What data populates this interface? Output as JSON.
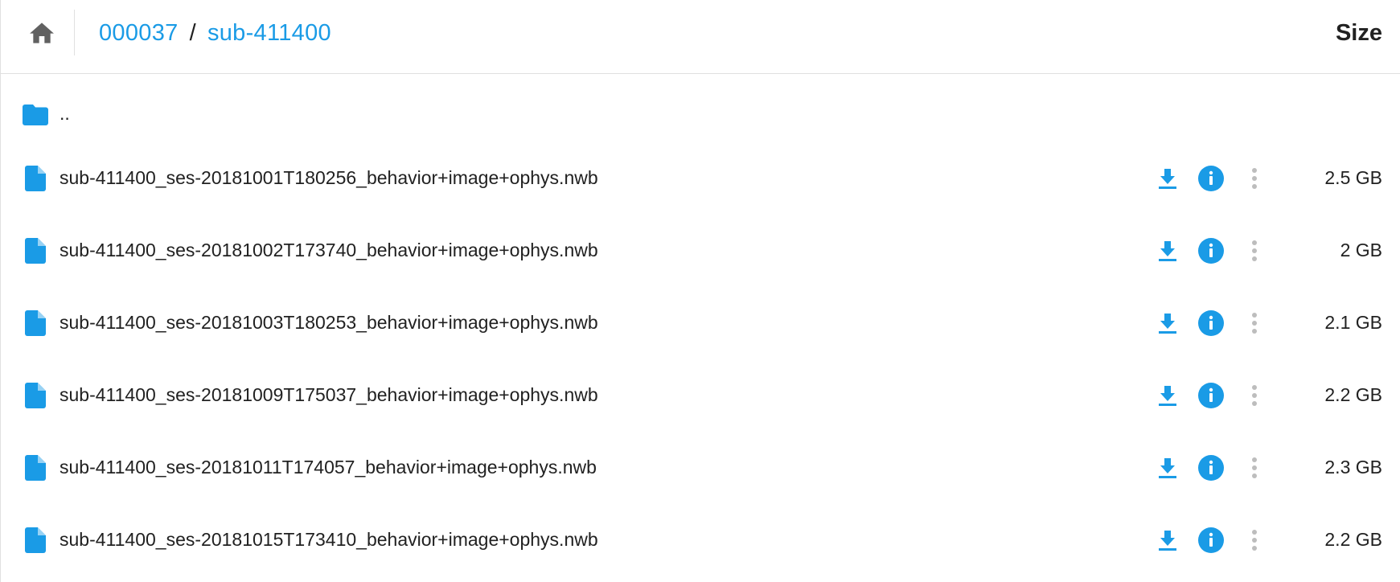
{
  "colors": {
    "accent": "#1a9be6",
    "icon_gray": "#616161",
    "more_gray": "#bdbdbd",
    "text": "#212121",
    "divider": "#e0e0e0"
  },
  "header": {
    "home_icon": "home-icon",
    "breadcrumb": [
      {
        "label": "000037"
      },
      {
        "label": "sub-411400"
      }
    ],
    "separator": "/",
    "size_label": "Size"
  },
  "parent_folder": {
    "icon": "folder-icon",
    "label": ".."
  },
  "files": [
    {
      "name": "sub-411400_ses-20181001T180256_behavior+image+ophys.nwb",
      "size": "2.5 GB"
    },
    {
      "name": "sub-411400_ses-20181002T173740_behavior+image+ophys.nwb",
      "size": "2 GB"
    },
    {
      "name": "sub-411400_ses-20181003T180253_behavior+image+ophys.nwb",
      "size": "2.1 GB"
    },
    {
      "name": "sub-411400_ses-20181009T175037_behavior+image+ophys.nwb",
      "size": "2.2 GB"
    },
    {
      "name": "sub-411400_ses-20181011T174057_behavior+image+ophys.nwb",
      "size": "2.3 GB"
    },
    {
      "name": "sub-411400_ses-20181015T173410_behavior+image+ophys.nwb",
      "size": "2.2 GB"
    }
  ],
  "file_actions": [
    "download-icon",
    "info-icon",
    "more-vert-icon"
  ]
}
